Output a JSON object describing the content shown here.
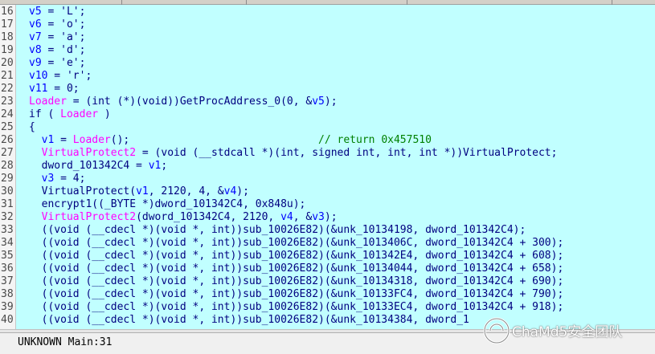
{
  "lines": [
    {
      "num": "16",
      "tokens": [
        {
          "t": "v5",
          "c": "var"
        },
        {
          "t": " = ",
          "c": "kw"
        },
        {
          "t": "'L'",
          "c": "kw"
        },
        {
          "t": ";",
          "c": "kw"
        }
      ]
    },
    {
      "num": "17",
      "tokens": [
        {
          "t": "v6",
          "c": "var"
        },
        {
          "t": " = ",
          "c": "kw"
        },
        {
          "t": "'o'",
          "c": "kw"
        },
        {
          "t": ";",
          "c": "kw"
        }
      ]
    },
    {
      "num": "18",
      "tokens": [
        {
          "t": "v7",
          "c": "var"
        },
        {
          "t": " = ",
          "c": "kw"
        },
        {
          "t": "'a'",
          "c": "kw"
        },
        {
          "t": ";",
          "c": "kw"
        }
      ]
    },
    {
      "num": "19",
      "tokens": [
        {
          "t": "v8",
          "c": "var"
        },
        {
          "t": " = ",
          "c": "kw"
        },
        {
          "t": "'d'",
          "c": "kw"
        },
        {
          "t": ";",
          "c": "kw"
        }
      ]
    },
    {
      "num": "20",
      "tokens": [
        {
          "t": "v9",
          "c": "var"
        },
        {
          "t": " = ",
          "c": "kw"
        },
        {
          "t": "'e'",
          "c": "kw"
        },
        {
          "t": ";",
          "c": "kw"
        }
      ]
    },
    {
      "num": "21",
      "tokens": [
        {
          "t": "v10",
          "c": "var"
        },
        {
          "t": " = ",
          "c": "kw"
        },
        {
          "t": "'r'",
          "c": "kw"
        },
        {
          "t": ";",
          "c": "kw"
        }
      ]
    },
    {
      "num": "22",
      "tokens": [
        {
          "t": "v11",
          "c": "var"
        },
        {
          "t": " = 0;",
          "c": "kw"
        }
      ]
    },
    {
      "num": "23",
      "tokens": [
        {
          "t": "Loader",
          "c": "gv"
        },
        {
          "t": " = (int (*)(void))GetProcAddress_0(0, &",
          "c": "kw"
        },
        {
          "t": "v5",
          "c": "var"
        },
        {
          "t": ");",
          "c": "kw"
        }
      ]
    },
    {
      "num": "24",
      "tokens": [
        {
          "t": "if ( ",
          "c": "kw"
        },
        {
          "t": "Loader",
          "c": "gv"
        },
        {
          "t": " )",
          "c": "kw"
        }
      ]
    },
    {
      "num": "25",
      "tokens": [
        {
          "t": "{",
          "c": "kw"
        }
      ]
    },
    {
      "num": "26",
      "tokens": [
        {
          "t": "  ",
          "c": "kw"
        },
        {
          "t": "v1",
          "c": "var"
        },
        {
          "t": " = ",
          "c": "kw"
        },
        {
          "t": "Loader",
          "c": "gv"
        },
        {
          "t": "();                              ",
          "c": "kw"
        },
        {
          "t": "// return 0x457510",
          "c": "cmt"
        }
      ]
    },
    {
      "num": "27",
      "tokens": [
        {
          "t": "  ",
          "c": "kw"
        },
        {
          "t": "VirtualProtect2",
          "c": "gv"
        },
        {
          "t": " = (void (__stdcall *)(int, signed int, int, int *))VirtualProtect;",
          "c": "kw"
        }
      ]
    },
    {
      "num": "28",
      "tokens": [
        {
          "t": "  ",
          "c": "kw"
        },
        {
          "t": "dword_101342C4",
          "c": "kw"
        },
        {
          "t": " = ",
          "c": "kw"
        },
        {
          "t": "v1",
          "c": "var"
        },
        {
          "t": ";",
          "c": "kw"
        }
      ]
    },
    {
      "num": "29",
      "tokens": [
        {
          "t": "  ",
          "c": "kw"
        },
        {
          "t": "v3",
          "c": "var"
        },
        {
          "t": " = 4;",
          "c": "kw"
        }
      ]
    },
    {
      "num": "30",
      "tokens": [
        {
          "t": "  VirtualProtect(",
          "c": "kw"
        },
        {
          "t": "v1",
          "c": "var"
        },
        {
          "t": ", 2120, 4, &",
          "c": "kw"
        },
        {
          "t": "v4",
          "c": "var"
        },
        {
          "t": ");",
          "c": "kw"
        }
      ]
    },
    {
      "num": "31",
      "tokens": [
        {
          "t": "  encrypt1((_BYTE *)dword_101342C4, 0x848u);",
          "c": "kw"
        }
      ]
    },
    {
      "num": "32",
      "tokens": [
        {
          "t": "  ",
          "c": "kw"
        },
        {
          "t": "VirtualProtect2",
          "c": "gv"
        },
        {
          "t": "(dword_101342C4, 2120, ",
          "c": "kw"
        },
        {
          "t": "v4",
          "c": "var"
        },
        {
          "t": ", &",
          "c": "kw"
        },
        {
          "t": "v3",
          "c": "var"
        },
        {
          "t": ");",
          "c": "kw"
        }
      ]
    },
    {
      "num": "33",
      "tokens": [
        {
          "t": "  ((void (__cdecl *)(void *, int))sub_10026E82)(&unk_10134198, dword_101342C4);",
          "c": "kw"
        }
      ]
    },
    {
      "num": "34",
      "tokens": [
        {
          "t": "  ((void (__cdecl *)(void *, int))sub_10026E82)(&unk_1013406C, dword_101342C4 + 300);",
          "c": "kw"
        }
      ]
    },
    {
      "num": "35",
      "tokens": [
        {
          "t": "  ((void (__cdecl *)(void *, int))sub_10026E82)(&unk_101342E4, dword_101342C4 + 608);",
          "c": "kw"
        }
      ]
    },
    {
      "num": "36",
      "tokens": [
        {
          "t": "  ((void (__cdecl *)(void *, int))sub_10026E82)(&unk_10134044, dword_101342C4 + 658);",
          "c": "kw"
        }
      ]
    },
    {
      "num": "37",
      "tokens": [
        {
          "t": "  ((void (__cdecl *)(void *, int))sub_10026E82)(&unk_10134318, dword_101342C4 + 690);",
          "c": "kw"
        }
      ]
    },
    {
      "num": "38",
      "tokens": [
        {
          "t": "  ((void (__cdecl *)(void *, int))sub_10026E82)(&unk_10133FC4, dword_101342C4 + 790);",
          "c": "kw"
        }
      ]
    },
    {
      "num": "39",
      "tokens": [
        {
          "t": "  ((void (__cdecl *)(void *, int))sub_10026E82)(&unk_10133EC4, dword_101342C4 + 918);",
          "c": "kw"
        }
      ]
    },
    {
      "num": "40",
      "tokens": [
        {
          "t": "  ((void (__cdecl *)(void *, int))sub_10026E82)(&unk_10134384, dword_1",
          "c": "kw"
        }
      ]
    }
  ],
  "status": {
    "text": "UNKNOWN Main:31"
  },
  "watermark": {
    "text": "ChaMd5安全团队",
    "icon": "chamd5-logo-icon"
  },
  "colors": {
    "background": "#c1ffff",
    "variable": "#0000ff",
    "global": "#ff00ff",
    "comment": "#008000",
    "text": "#000080"
  }
}
